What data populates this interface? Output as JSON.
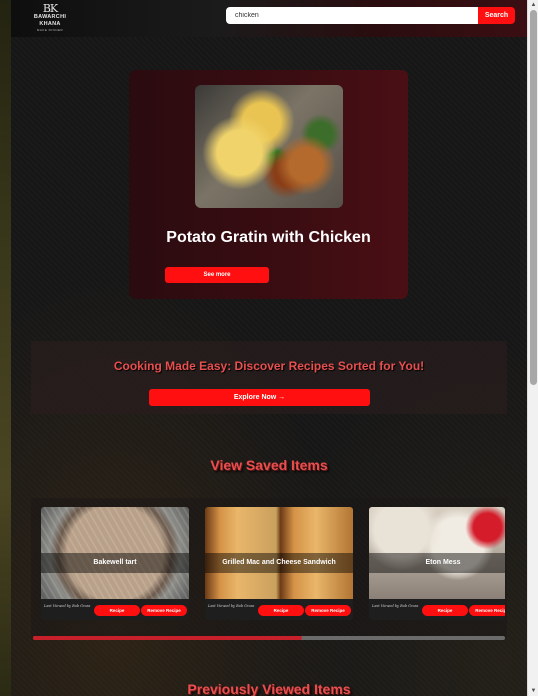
{
  "header": {
    "logo_mark": "BK",
    "logo_name": "BAWARCHI KHANA",
    "logo_tagline": "MAKE DINNER",
    "search": {
      "value": "chicken",
      "button_label": "Search"
    }
  },
  "hero": {
    "title": "Potato Gratin with Chicken",
    "button_label": "See more"
  },
  "banner": {
    "headline": "Cooking Made Easy: Discover Recipes Sorted for You!",
    "button_label": "Explore Now →"
  },
  "saved": {
    "heading": "View Saved Items",
    "items": [
      {
        "name": "Bakewell tart",
        "viewed": "Last Viewed by Bob Gross",
        "recipe_label": "Recipe",
        "remove_label": "Remove Recipe"
      },
      {
        "name": "Grilled Mac and Cheese Sandwich",
        "viewed": "Last Viewed by Bob Gross",
        "recipe_label": "Recipe",
        "remove_label": "Remove Recipe"
      },
      {
        "name": "Eton Mess",
        "viewed": "Last Viewed by Bob Gross",
        "recipe_label": "Recipe",
        "remove_label": "Remove Recipe"
      }
    ],
    "scroll_progress": 0.57
  },
  "previous": {
    "heading": "Previously Viewed Items"
  },
  "colors": {
    "accent": "#ff0f0f",
    "heading": "#e84f4f"
  }
}
